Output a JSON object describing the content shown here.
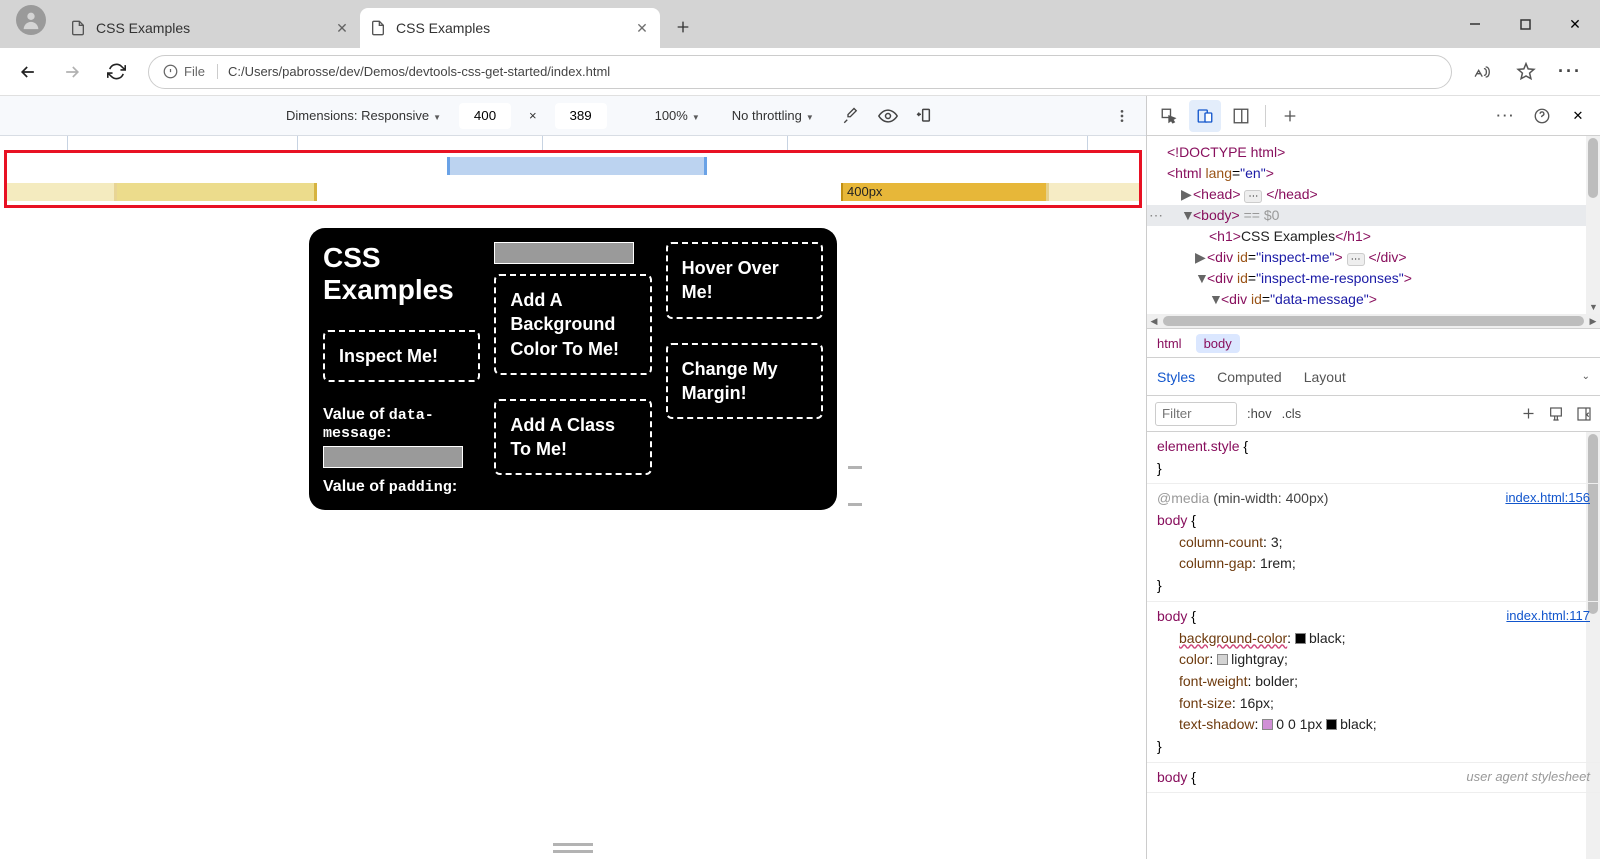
{
  "browser": {
    "tabs": [
      {
        "title": "CSS Examples",
        "active": false
      },
      {
        "title": "CSS Examples",
        "active": true
      }
    ],
    "url": "C:/Users/pabrosse/dev/Demos/devtools-css-get-started/index.html",
    "url_scheme": "File"
  },
  "device_toolbar": {
    "dimensions_label": "Dimensions: Responsive",
    "width": "400",
    "times": "×",
    "height": "389",
    "zoom": "100%",
    "throttling": "No throttling"
  },
  "mq_ruler": {
    "label_400": "400px"
  },
  "page": {
    "h1": "CSS Examples",
    "boxes": {
      "inspect": "Inspect Me!",
      "bg": "Add A Background Color To Me!",
      "class": "Add A Class To Me!",
      "hover": "Hover Over Me!",
      "margin": "Change My Margin!"
    },
    "responses": {
      "data_message_label_a": "Value of ",
      "data_message_label_b": "data-message",
      "data_message_label_c": ":",
      "padding_label_a": "Value of ",
      "padding_label_b": "padding",
      "padding_label_c": ":"
    }
  },
  "dom": {
    "lines": [
      "<!DOCTYPE html>",
      "<html lang=\"en\">",
      "<head> … </head>",
      "<body> == $0",
      "<h1>CSS Examples</h1>",
      "<div id=\"inspect-me\"> … </div>",
      "<div id=\"inspect-me-responses\">",
      "<div id=\"data-message\">"
    ],
    "breadcrumbs": [
      "html",
      "body"
    ]
  },
  "styles": {
    "tabs": [
      "Styles",
      "Computed",
      "Layout"
    ],
    "filter_placeholder": "Filter",
    "toolbar": {
      "hov": ":hov",
      "cls": ".cls"
    },
    "element_style": {
      "selector": "element.style",
      "open": "{",
      "close": "}"
    },
    "rule1": {
      "media": "@media (min-width: 400px)",
      "selector": "body",
      "src": "index.html:156",
      "props": {
        "column-count": "3;",
        "column-gap": "1rem;"
      }
    },
    "rule2": {
      "selector": "body",
      "src": "index.html:117",
      "props": {
        "background-color": "black;",
        "color": "lightgray;",
        "font-weight": "bolder;",
        "font-size": "16px;",
        "text-shadow": "0 0 1px",
        "text-shadow-end": "black;"
      }
    },
    "rule3": {
      "selector": "body",
      "src": "user agent stylesheet"
    }
  }
}
